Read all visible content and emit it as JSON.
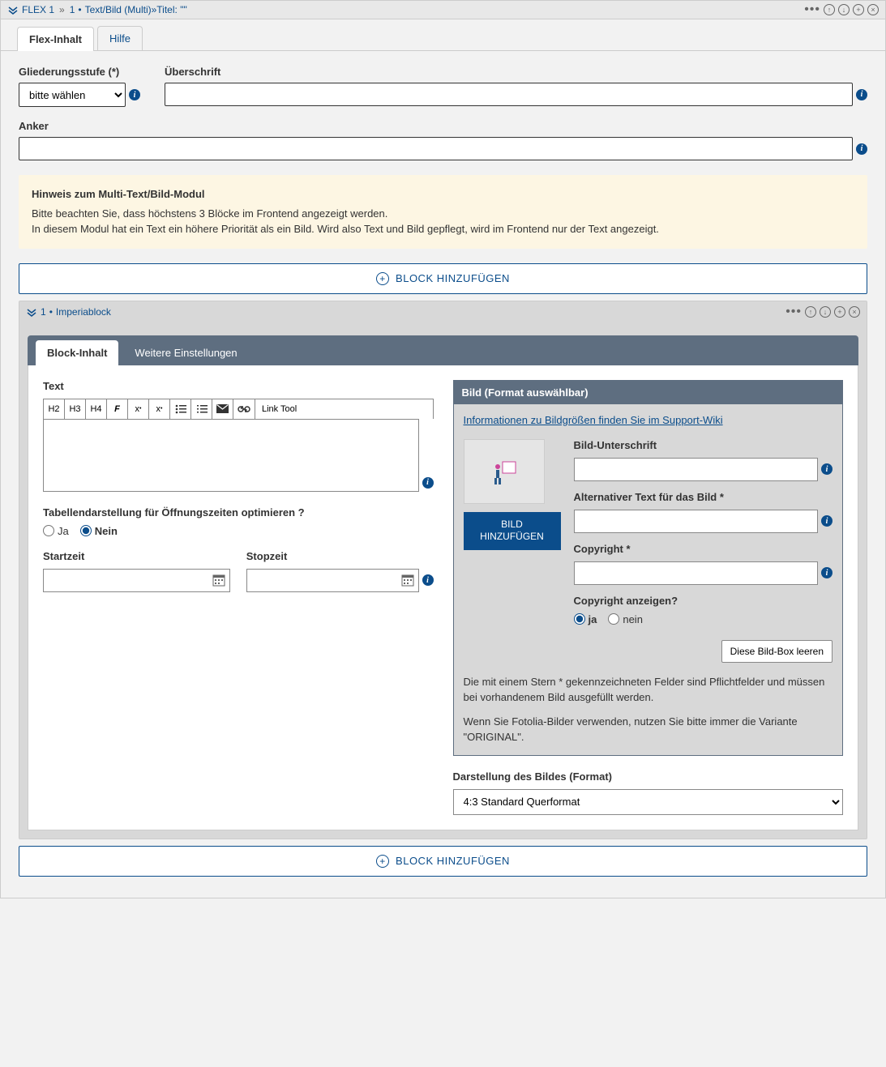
{
  "titlebar": {
    "title_prefix": "FLEX 1",
    "title_num": "1",
    "title_rest": "Text/Bild (Multi)»Titel: \"\""
  },
  "tabs": {
    "flex_inhalt": "Flex-Inhalt",
    "hilfe": "Hilfe"
  },
  "labels": {
    "gliederungsstufe": "Gliederungsstufe (*)",
    "ueberschrift": "Überschrift",
    "anker": "Anker"
  },
  "select_gliederung": {
    "option": "bitte wählen"
  },
  "hint": {
    "title": "Hinweis zum Multi-Text/Bild-Modul",
    "line1": "Bitte beachten Sie, dass höchstens 3 Blöcke im Frontend angezeigt werden.",
    "line2": "In diesem Modul hat ein Text ein höhere Priorität als ein Bild. Wird also Text und Bild gepflegt, wird im Frontend nur der Text angezeigt."
  },
  "add_block_label": "BLOCK HINZUFÜGEN",
  "sub": {
    "title_num": "1",
    "title_name": "Imperiablock",
    "tabs": {
      "block_inhalt": "Block-Inhalt",
      "weitere": "Weitere Einstellungen"
    }
  },
  "editor": {
    "text_label": "Text",
    "btn_h2": "H2",
    "btn_h3": "H3",
    "btn_h4": "H4",
    "btn_bold": "F",
    "btn_sup": "x",
    "btn_sub": "x",
    "btn_link_tool": "Link Tool",
    "table_question": "Tabellendarstellung für Öffnungszeiten optimieren ?",
    "ja": "Ja",
    "nein": "Nein",
    "startzeit": "Startzeit",
    "stopzeit": "Stopzeit"
  },
  "bild": {
    "header": "Bild (Format auswählbar)",
    "info_link": "Informationen zu Bildgrößen finden Sie im Support-Wiki",
    "add_btn": "BILD HINZUFÜGEN",
    "unterschrift_label": "Bild-Unterschrift",
    "alt_label": "Alternativer Text für das Bild *",
    "copyright_label": "Copyright *",
    "copyright_show_label": "Copyright anzeigen?",
    "ja": "ja",
    "nein": "nein",
    "clear_btn": "Diese Bild-Box leeren",
    "note1": "Die mit einem Stern * gekennzeichneten Felder sind Pflichtfelder und müssen bei vorhandenem Bild ausgefüllt werden.",
    "note2": "Wenn Sie Fotolia-Bilder verwenden, nutzen Sie bitte immer die Variante \"ORIGINAL\".",
    "format_label": "Darstellung des Bildes (Format)",
    "format_option": "4:3 Standard Querformat"
  }
}
